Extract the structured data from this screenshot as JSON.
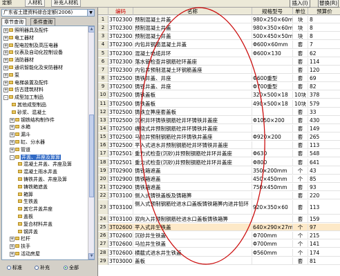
{
  "top_tabs": [
    "定额",
    "人材机",
    "补充人材机"
  ],
  "top_buttons": {
    "insert": "插入(I)",
    "replace": "替换(R)"
  },
  "left_panel": {
    "department": "广东省土建资料综合定额(2006)",
    "tabs": [
      "章节查询",
      "条件查询"
    ],
    "tree": [
      {
        "level": 0,
        "toggle": "+",
        "label": "照明器具及配件"
      },
      {
        "level": 0,
        "toggle": "+",
        "label": "电工器材"
      },
      {
        "level": 0,
        "toggle": "+",
        "label": "配电控制及高压电器"
      },
      {
        "level": 0,
        "toggle": "+",
        "label": "仪表及自动化控制设备"
      },
      {
        "level": 0,
        "toggle": "+",
        "label": "消防器材"
      },
      {
        "level": 0,
        "toggle": "+",
        "label": "通讯智能化及安防器材"
      },
      {
        "level": 0,
        "toggle": "+",
        "label": "泵"
      },
      {
        "level": 0,
        "toggle": "+",
        "label": "电梯装置及配件"
      },
      {
        "level": 0,
        "toggle": "+",
        "label": "仿古建筑材料"
      },
      {
        "level": 0,
        "toggle": "-",
        "label": "成型加工制品"
      },
      {
        "level": 1,
        "toggle": "",
        "label": "其他成型制品"
      },
      {
        "level": 1,
        "toggle": "",
        "label": "砂浆、混凝土"
      },
      {
        "level": 1,
        "toggle": "+",
        "label": "钢铁结构制作件"
      },
      {
        "level": 1,
        "toggle": "+",
        "label": "水箱"
      },
      {
        "level": 1,
        "toggle": "+",
        "label": "漏斗"
      },
      {
        "level": 1,
        "toggle": "+",
        "label": "缸、分水器"
      },
      {
        "level": 1,
        "toggle": "+",
        "label": "管道"
      },
      {
        "level": 1,
        "toggle": "-",
        "label": "井盖、井座及箅箅",
        "selected": true
      },
      {
        "level": 2,
        "toggle": "",
        "label": "混凝土井盖、井座及箅"
      },
      {
        "level": 2,
        "toggle": "",
        "label": "混凝土雨水井盖"
      },
      {
        "level": 2,
        "toggle": "",
        "label": "铸铁井盖、井座及箅"
      },
      {
        "level": 2,
        "toggle": "",
        "label": "铸铁箱遮盖"
      },
      {
        "level": 2,
        "toggle": "",
        "label": "箱箅"
      },
      {
        "level": 2,
        "toggle": "",
        "label": "生铁盖"
      },
      {
        "level": 2,
        "toggle": "",
        "label": "其它井盖井座"
      },
      {
        "level": 2,
        "toggle": "",
        "label": "盖板"
      },
      {
        "level": 2,
        "toggle": "",
        "label": "复合材料井盖"
      },
      {
        "level": 2,
        "toggle": "",
        "label": "钢井盖"
      },
      {
        "level": 1,
        "toggle": "+",
        "label": "栏杆"
      },
      {
        "level": 1,
        "toggle": "+",
        "label": "扶手"
      },
      {
        "level": 1,
        "toggle": "+",
        "label": "活动房屋"
      }
    ],
    "radios": [
      {
        "label": "标准",
        "checked": false
      },
      {
        "label": "补充",
        "checked": false
      },
      {
        "label": "全部",
        "checked": true
      }
    ]
  },
  "grid": {
    "columns": {
      "code": "编码",
      "name": "名称",
      "spec": "规格型号",
      "unit": "单位",
      "price": "预算价"
    },
    "rows": [
      {
        "n": "1",
        "code": "3T023001",
        "name": "预制混凝土井盖",
        "spec": "980×250×60mm",
        "unit": "块",
        "price": "8"
      },
      {
        "n": "2",
        "code": "3T023002",
        "name": "预制混凝土井盖",
        "spec": "980×350×60mm",
        "unit": "块",
        "price": "8"
      },
      {
        "n": "3",
        "code": "3T023003",
        "name": "预制混凝土井盖",
        "spec": "500×450×50mm",
        "unit": "块",
        "price": "8"
      },
      {
        "n": "4",
        "code": "3T023004",
        "name": "内包井钢筋混凝土井盖",
        "spec": "Φ600×60mm",
        "unit": "套",
        "price": "7"
      },
      {
        "n": "5",
        "code": "3T023005",
        "name": "混凝土电缆井环",
        "spec": "Φ600×130",
        "unit": "套",
        "price": "62"
      },
      {
        "n": "6",
        "code": "3T023006",
        "name": "落水管检查井钢筋砼环盖座",
        "spec": "",
        "unit": "套",
        "price": "114"
      },
      {
        "n": "7",
        "code": "3T023007",
        "name": "内包井预制混凝土环钢筋盖座",
        "spec": "",
        "unit": "套",
        "price": "120"
      },
      {
        "n": "8",
        "code": "3T025001",
        "name": "铸铁井盖、井座",
        "spec": "Φ600重型",
        "unit": "套",
        "price": "69"
      },
      {
        "n": "9",
        "code": "3T025002",
        "name": "铸铁井盖、井座",
        "spec": "Φ700重型",
        "unit": "套",
        "price": "82"
      },
      {
        "n": "10",
        "code": "3T025003",
        "name": "铸铁盖板",
        "spec": "320×500×18",
        "unit": "10块",
        "price": "378"
      },
      {
        "n": "11",
        "code": "3T025004",
        "name": "铸铁盖板",
        "spec": "490×500×18",
        "unit": "10块",
        "price": "579"
      },
      {
        "n": "12",
        "code": "3T025005",
        "name": "铸铁立箅座套盖板",
        "spec": "",
        "unit": "套",
        "price": "33"
      },
      {
        "n": "13",
        "code": "3T025006",
        "name": "沉积井环铸铁钢筋砼井环铸铁井盖座",
        "spec": "Φ1050×200",
        "unit": "套",
        "price": "430"
      },
      {
        "n": "14",
        "code": "3T025007",
        "name": "缠绕式井预制钢筋砼井环铸铁井盖座",
        "spec": "",
        "unit": "套",
        "price": "149"
      },
      {
        "n": "15",
        "code": "3T025008",
        "name": "马拉井预制钢筋砼井环铸铁井盖座",
        "spec": "Φ920×200",
        "unit": "套",
        "price": "265"
      },
      {
        "n": "16",
        "code": "3T025009",
        "name": "平入式进水井预制钢筋砼井环铸铁井盖座",
        "spec": "",
        "unit": "套",
        "price": "113"
      },
      {
        "n": "17",
        "code": "3T025010",
        "name": "重力式检查(沉砂)井预制钢筋砼井环井盖座",
        "spec": "Φ630",
        "unit": "套",
        "price": "548"
      },
      {
        "n": "18",
        "code": "3T025011",
        "name": "重力式检查(沉砂)井预制钢筋砼井环井盖座",
        "spec": "Φ800",
        "unit": "套",
        "price": "641"
      },
      {
        "n": "19",
        "code": "3T029001",
        "name": "铸铁箱遮盖",
        "spec": "350×200mm",
        "unit": "个",
        "price": "43"
      },
      {
        "n": "20",
        "code": "3T029002",
        "name": "铸铁箱遮盖",
        "spec": "450×450mm",
        "unit": "个",
        "price": "85"
      },
      {
        "n": "21",
        "code": "3T029003",
        "name": "铸铁箱遮盖",
        "spec": "750×450mm",
        "unit": "套",
        "price": "93"
      },
      {
        "n": "22",
        "code": "3T031001",
        "name": "侧入式铸铁盖板及铸箱箅",
        "spec": "",
        "unit": "套",
        "price": "220"
      },
      {
        "n": "23",
        "code": "3T031002",
        "name": "侧入式预制钢筋砼进水口盖板铸铁箱箅内进井铅环",
        "spec": "920×350×60",
        "unit": "套",
        "price": "113",
        "tall": true
      },
      {
        "n": "24",
        "code": "3T031003",
        "name": "双向入井预制钢筋砼进水口盖板铸铁箱箅",
        "spec": "",
        "unit": "套",
        "price": "159"
      },
      {
        "n": "25",
        "code": "3T026001",
        "name": "平入式井生铁盖",
        "spec": "640×290×27mm",
        "unit": "个",
        "price": "97",
        "selected": true
      },
      {
        "n": "26",
        "code": "3T026002",
        "name": "沉砂井生铁盖",
        "spec": "Φ700mm",
        "unit": "个",
        "price": "215"
      },
      {
        "n": "27",
        "code": "3T026003",
        "name": "马拉井生铁盖",
        "spec": "Φ700mm",
        "unit": "个",
        "price": "141"
      },
      {
        "n": "28",
        "code": "3T026004",
        "name": "横截式进水井生铁盖",
        "spec": "Φ560mm",
        "unit": "个",
        "price": "174"
      },
      {
        "n": "29",
        "code": "3T030001",
        "name": "盖板",
        "spec": "",
        "unit": "套",
        "price": "81"
      }
    ]
  }
}
